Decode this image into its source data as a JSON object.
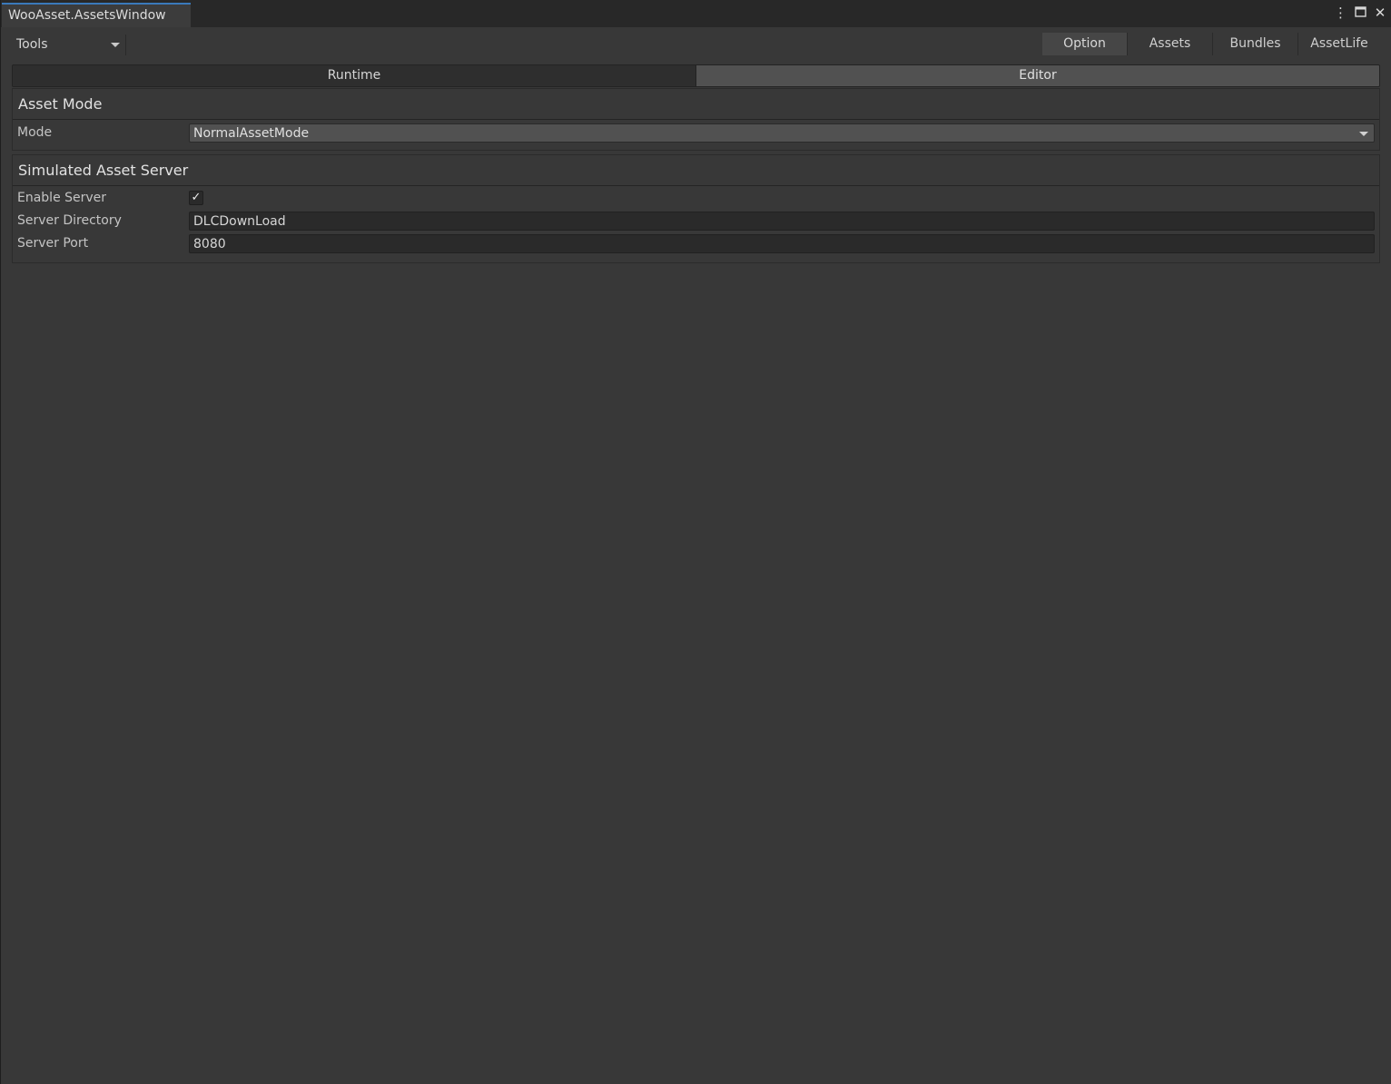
{
  "window": {
    "title": "WooAsset.AssetsWindow",
    "controls": {
      "menu_icon": "⋮",
      "maximize_icon": "🗖",
      "close_icon": "✕"
    }
  },
  "toolbar": {
    "tools_label": "Tools",
    "tabs": [
      {
        "label": "Option",
        "active": true
      },
      {
        "label": "Assets",
        "active": false
      },
      {
        "label": "Bundles",
        "active": false
      },
      {
        "label": "AssetLife",
        "active": false
      }
    ]
  },
  "segmented": {
    "options": [
      {
        "label": "Runtime",
        "selected": false
      },
      {
        "label": "Editor",
        "selected": true
      }
    ]
  },
  "asset_mode": {
    "header": "Asset Mode",
    "mode_label": "Mode",
    "mode_value": "NormalAssetMode"
  },
  "server": {
    "header": "Simulated Asset Server",
    "enable_label": "Enable Server",
    "enabled": true,
    "check_glyph": "✓",
    "directory_label": "Server Directory",
    "directory_value": "DLCDownLoad",
    "port_label": "Server Port",
    "port_value": "8080"
  }
}
